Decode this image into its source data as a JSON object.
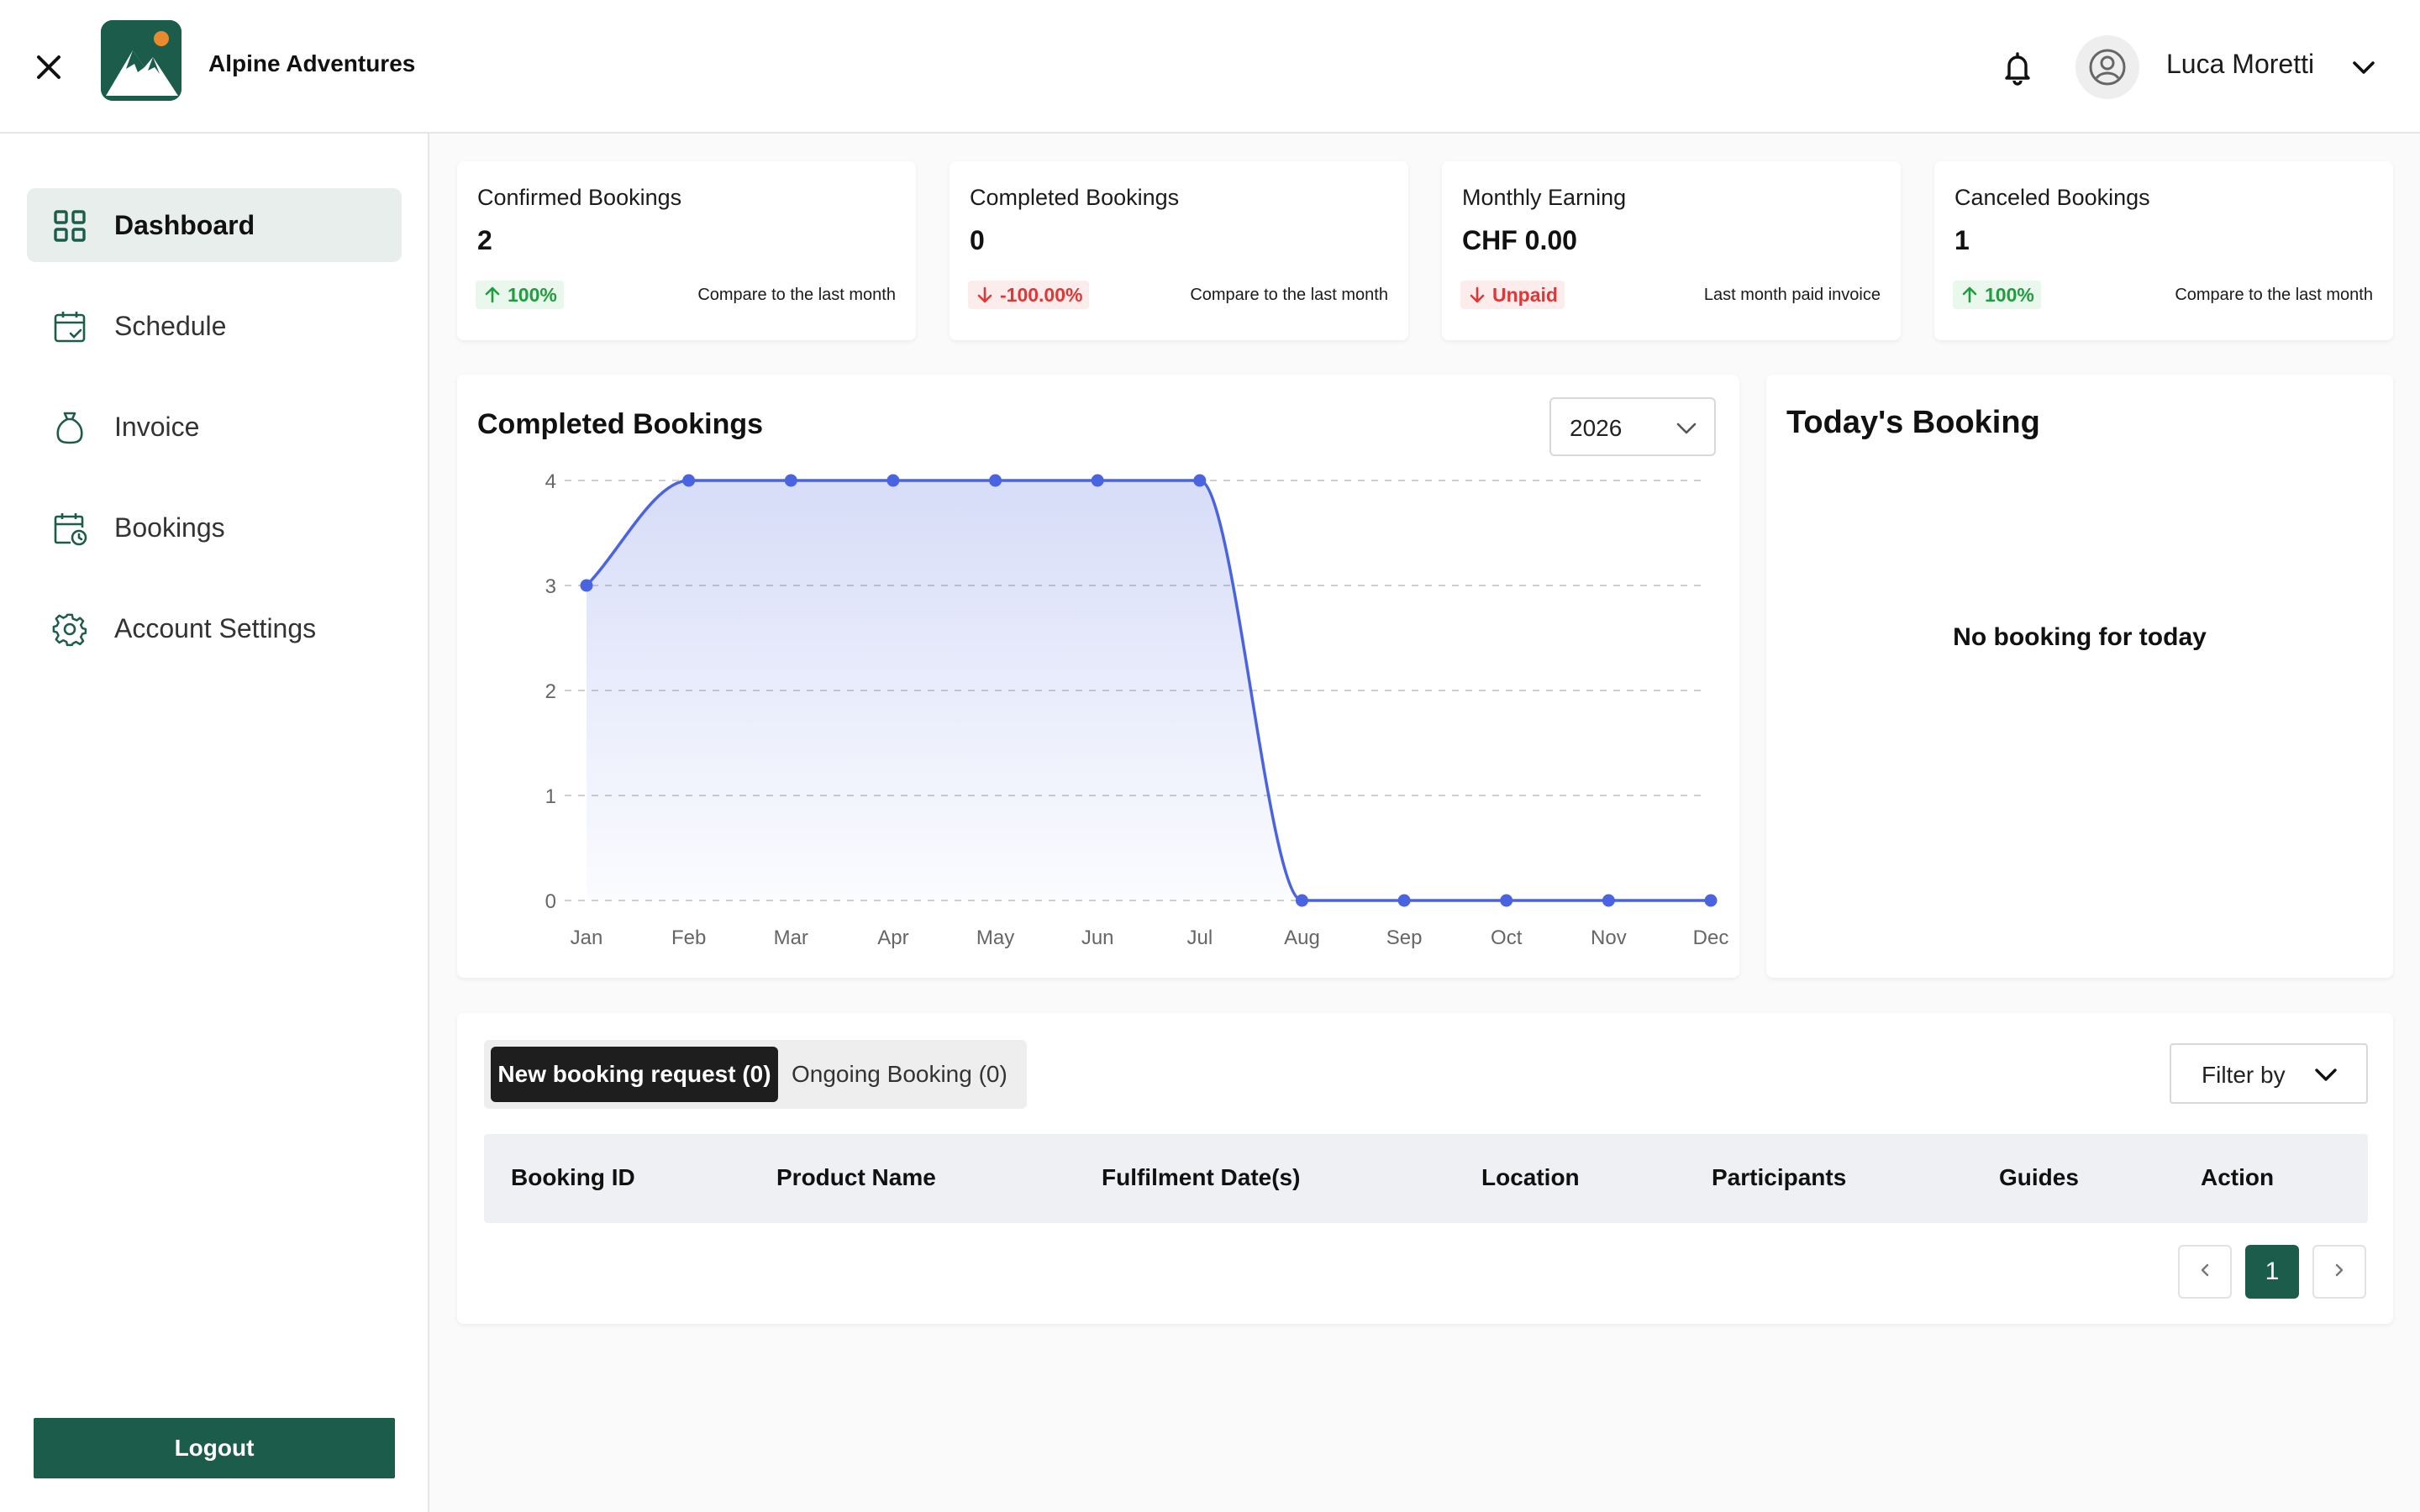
{
  "header": {
    "brand": "Alpine Adventures",
    "user_name": "Luca Moretti"
  },
  "sidebar": {
    "items": [
      {
        "label": "Dashboard",
        "icon": "dashboard-grid-icon",
        "active": true
      },
      {
        "label": "Schedule",
        "icon": "calendar-check-icon",
        "active": false
      },
      {
        "label": "Invoice",
        "icon": "money-bag-icon",
        "active": false
      },
      {
        "label": "Bookings",
        "icon": "calendar-clock-icon",
        "active": false
      },
      {
        "label": "Account Settings",
        "icon": "gear-icon",
        "active": false
      }
    ],
    "logout_label": "Logout"
  },
  "stats": [
    {
      "title": "Confirmed Bookings",
      "value": "2",
      "trend": "100%",
      "trend_dir": "up",
      "note": "Compare to the last month"
    },
    {
      "title": "Completed Bookings",
      "value": "0",
      "trend": "-100.00%",
      "trend_dir": "down",
      "note": "Compare to the last month"
    },
    {
      "title": "Monthly Earning",
      "value": "CHF 0.00",
      "trend": "Unpaid",
      "trend_dir": "down",
      "note": "Last month paid invoice"
    },
    {
      "title": "Canceled Bookings",
      "value": "1",
      "trend": "100%",
      "trend_dir": "up",
      "note": "Compare to the last month"
    }
  ],
  "chart_panel": {
    "title": "Completed Bookings",
    "year": "2026"
  },
  "chart_data": {
    "type": "area",
    "categories": [
      "Jan",
      "Feb",
      "Mar",
      "Apr",
      "May",
      "Jun",
      "Jul",
      "Aug",
      "Sep",
      "Oct",
      "Nov",
      "Dec"
    ],
    "values": [
      3,
      4,
      4,
      4,
      4,
      4,
      4,
      0,
      0,
      0,
      0,
      0
    ],
    "yticks": [
      "0",
      "1",
      "2",
      "3",
      "4"
    ],
    "ylim": [
      0,
      4
    ],
    "title": "Completed Bookings",
    "xlabel": "",
    "ylabel": "",
    "grid": true,
    "color": "#4a63e0"
  },
  "today": {
    "title": "Today's Booking",
    "empty_text": "No booking for today"
  },
  "bookings": {
    "tabs": [
      {
        "label": "New booking request (0)",
        "active": true
      },
      {
        "label": "Ongoing Booking (0)",
        "active": false
      }
    ],
    "filter_label": "Filter by",
    "columns": [
      "Booking ID",
      "Product Name",
      "Fulfilment Date(s)",
      "Location",
      "Participants",
      "Guides",
      "Action"
    ],
    "rows": [],
    "pagination": {
      "current": "1"
    }
  },
  "colors": {
    "brand": "#1c5c4a",
    "chart_line": "#4a63e0",
    "positive": "#1f9d3f",
    "negative": "#e03636"
  }
}
